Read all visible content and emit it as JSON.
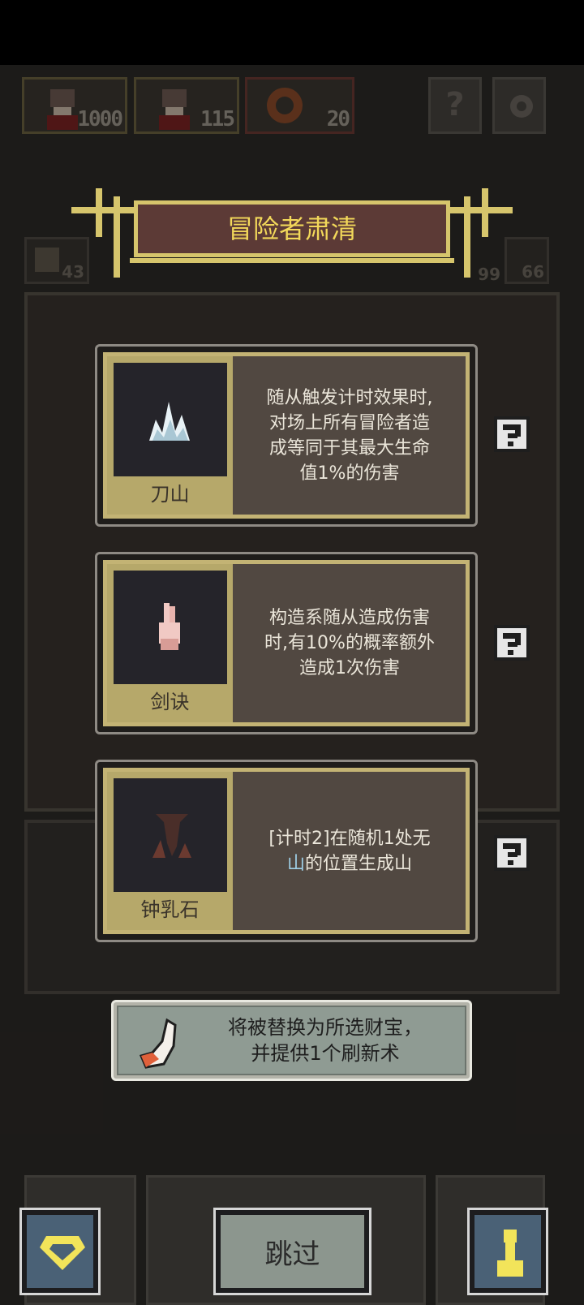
{
  "resources": [
    {
      "name": "adventurer-count-a",
      "count": "1000",
      "icon": "adventurer-icon"
    },
    {
      "name": "adventurer-count-b",
      "count": "115",
      "icon": "adventurer-icon"
    },
    {
      "name": "coin-count",
      "count": "20",
      "icon": "coin-icon"
    }
  ],
  "top_buttons": {
    "help": "?",
    "settings": "gear-icon"
  },
  "small_counters": {
    "left": "43",
    "right_a": "99",
    "right_b": "66"
  },
  "banner": {
    "title": "冒险者肃清"
  },
  "cards": [
    {
      "name": "刀山",
      "icon": "blade-mountain-icon",
      "desc": "随从触发计时效果时,\n对场上所有冒险者造\n成等同于其最大生命\n值1%的伤害"
    },
    {
      "name": "剑诀",
      "icon": "sword-hand-icon",
      "desc": "构造系随从造成伤害\n时,有10%的概率额外\n造成1次伤害"
    },
    {
      "name": "钟乳石",
      "icon": "stalactite-icon",
      "desc_pre": "[计时2]在随机1处无",
      "desc_hl": "山",
      "desc_post": "的位置生成山"
    }
  ],
  "tooltip": {
    "text": "将被替换为所选财宝，\n并提供1个刷新术",
    "icon": "fox-tail-icon"
  },
  "bottom": {
    "left_icon": "gem-icon",
    "skip_label": "跳过",
    "right_icon": "pawn-icon"
  },
  "colors": {
    "gold": "#d6c56c",
    "banner_bg": "#5c3a36",
    "card_frame": "#c3b374",
    "highlight": "#9fd0e8"
  }
}
